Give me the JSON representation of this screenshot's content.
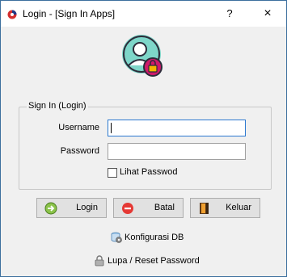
{
  "window": {
    "title": "Login - [Sign In Apps]",
    "help_glyph": "?",
    "close_glyph": "×"
  },
  "group": {
    "title": "Sign In (Login)"
  },
  "form": {
    "username_label": "Username",
    "username_value": "",
    "password_label": "Password",
    "password_value": "",
    "show_password_label": "Lihat Passwod",
    "show_password_checked": false
  },
  "buttons": {
    "login": "Login",
    "cancel": "Batal",
    "exit": "Keluar"
  },
  "links": {
    "db_config": "Konfigurasi DB",
    "reset_password": "Lupa / Reset Password"
  },
  "colors": {
    "avatar_circle": "#7ed6c9",
    "lock_badge": "#d0196a",
    "focus_border": "#2b78d0",
    "login_icon": "#4caf50",
    "cancel_icon": "#e53935"
  }
}
